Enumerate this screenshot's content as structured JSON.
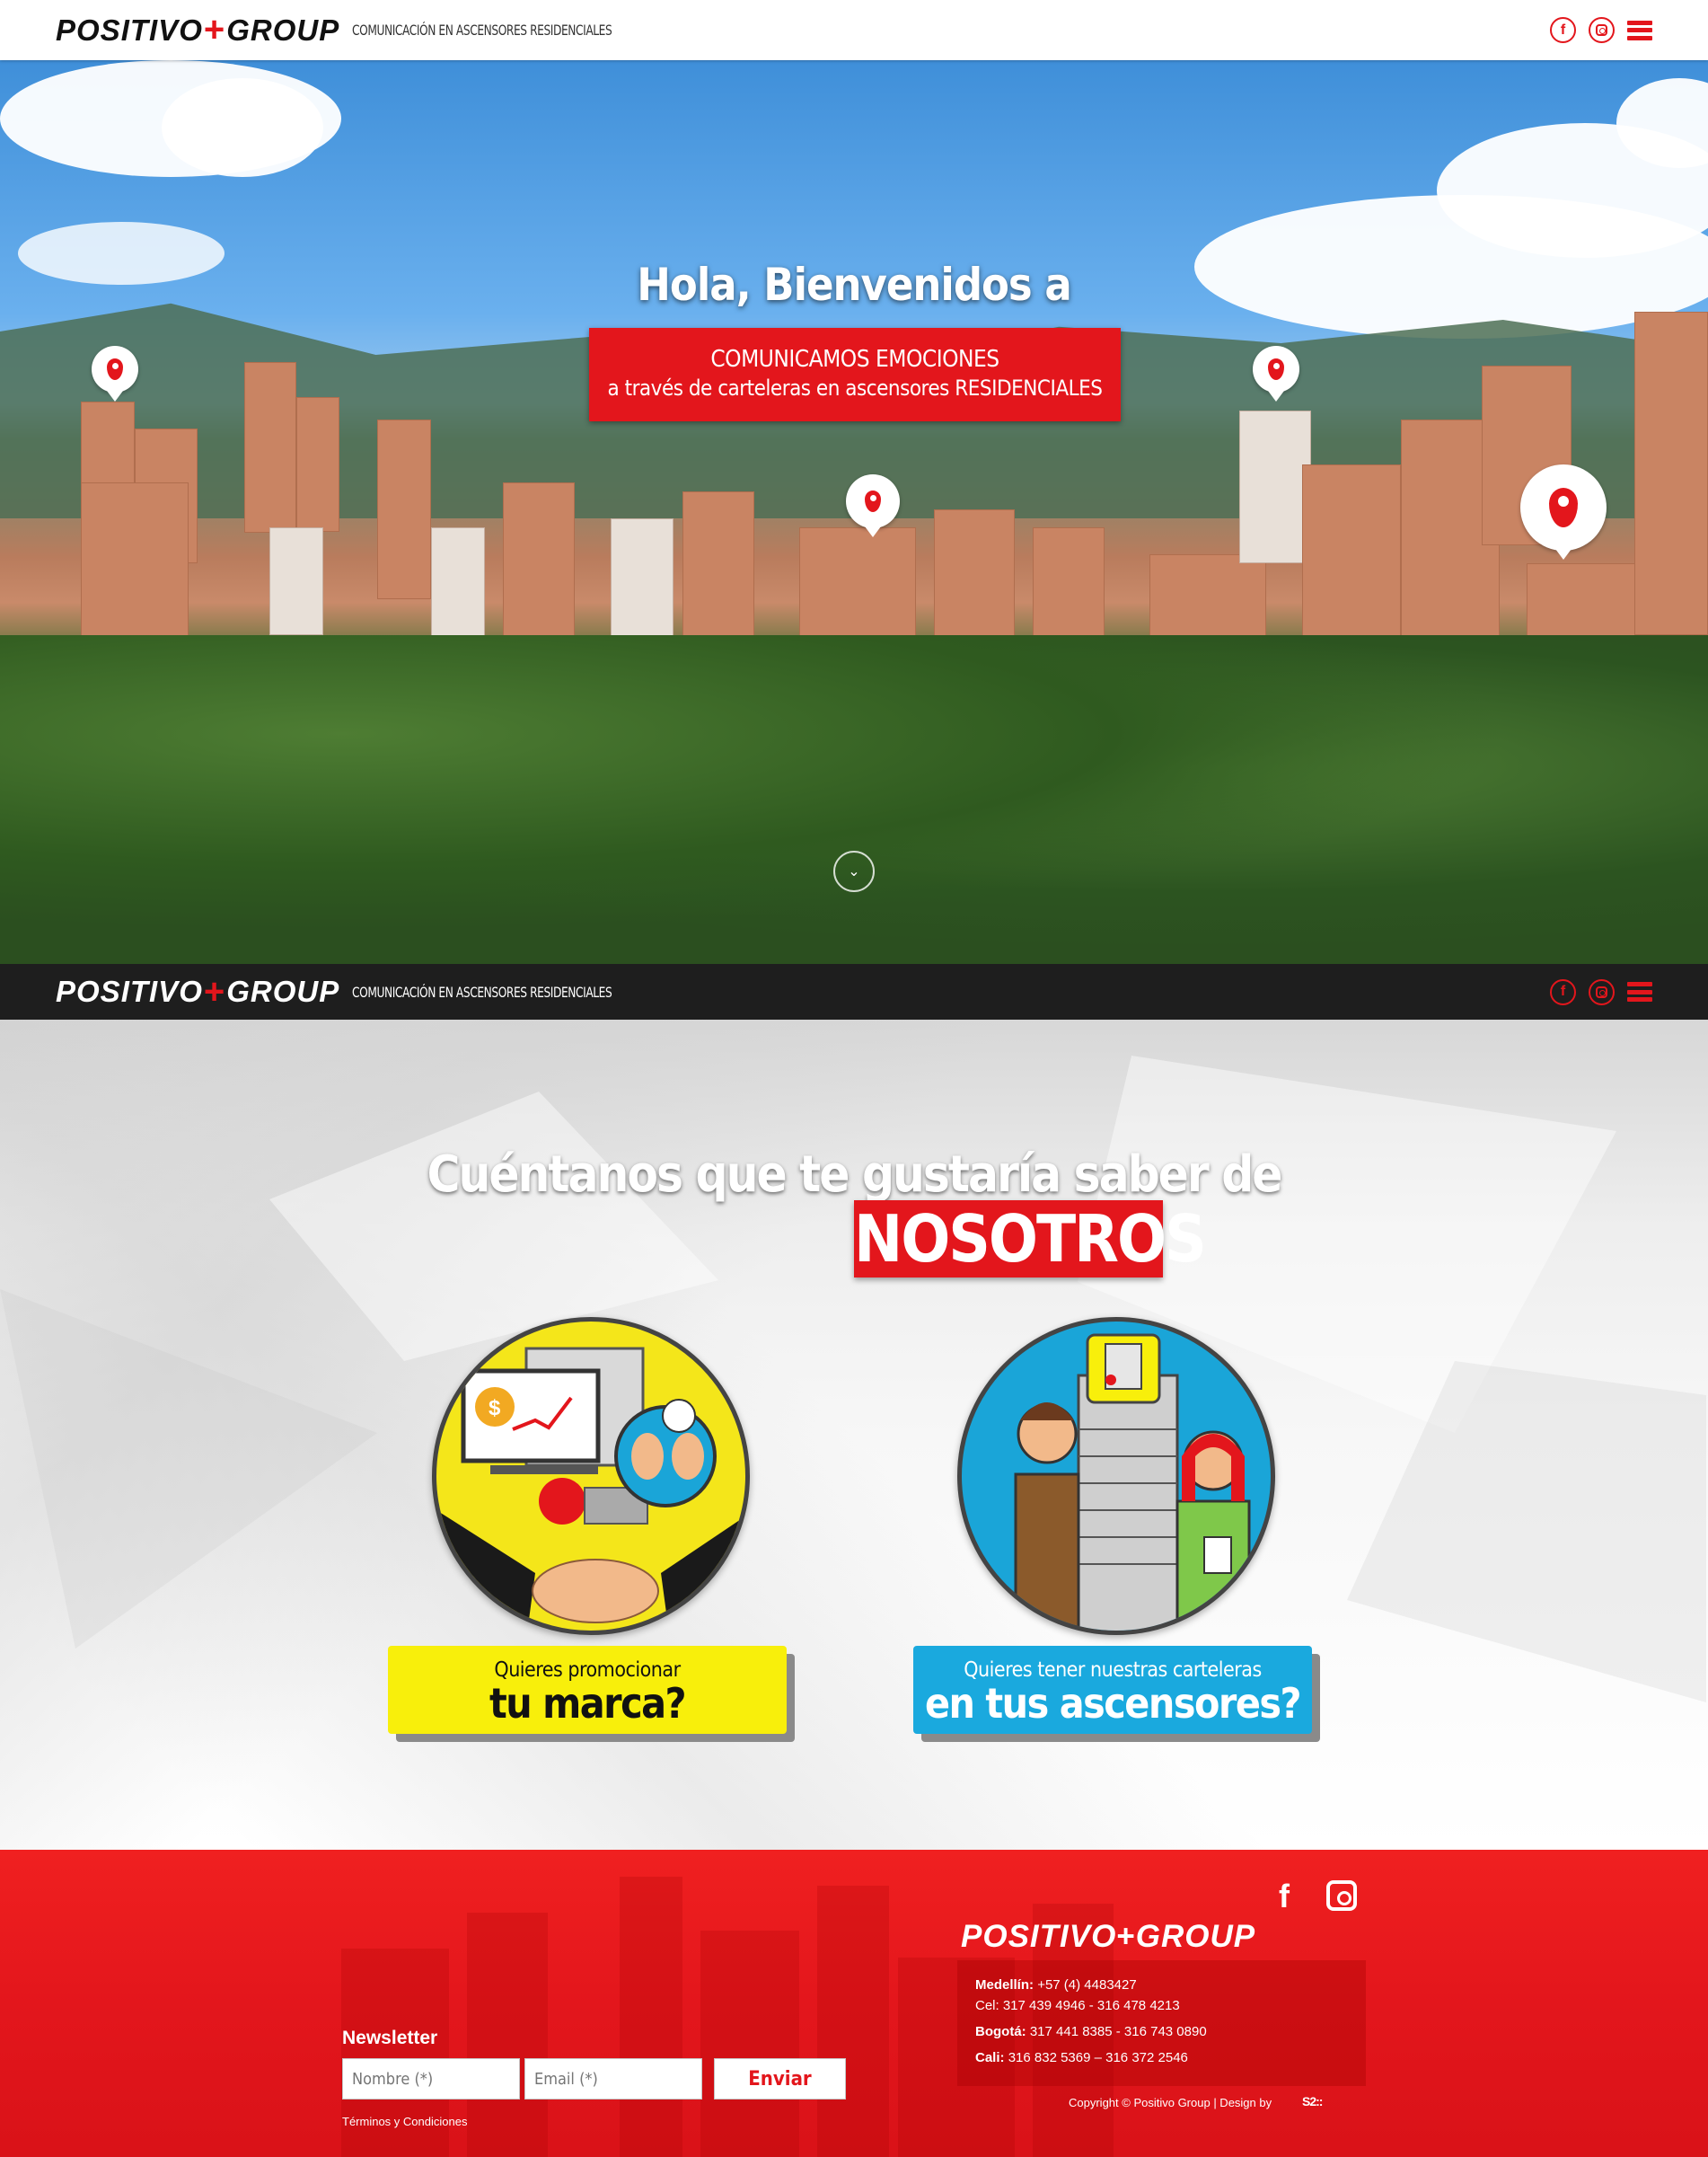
{
  "header": {
    "logo_left": "POSITIVO",
    "logo_plus": "+",
    "logo_right": "GROUP",
    "tagline": "COMUNICACIÓN EN ASCENSORES RESIDENCIALES",
    "facebook_glyph": "f",
    "icons": [
      "facebook-icon",
      "instagram-icon",
      "menu-icon"
    ]
  },
  "hero": {
    "title": "Hola, Bienvenidos a",
    "box_line1": "COMUNICAMOS EMOCIONES",
    "box_line2": "a través de carteleras en ascensores RESIDENCIALES",
    "scroll_glyph": "⌄"
  },
  "info": {
    "title_line1": "Cuéntanos que te gustaría saber de",
    "title_highlight": "NOSOTROS",
    "cards": [
      {
        "small": "Quieres promocionar",
        "large": "tu marca?"
      },
      {
        "small": "Quieres tener nuestras carteleras",
        "large": "en tus ascensores?"
      }
    ]
  },
  "footer": {
    "facebook_glyph": "f",
    "logo_left": "POSITIVO",
    "logo_plus": "+",
    "logo_right": "GROUP",
    "contacts": [
      {
        "city": "Medellín:",
        "phones": "+57 (4) 4483427"
      },
      {
        "city": "",
        "phones": "Cel: 317 439 4946 - 316 478 4213"
      },
      {
        "city": "Bogotá:",
        "phones": "317 441 8385 - 316 743 0890"
      },
      {
        "city": "Cali:",
        "phones": "316 832 5369 – 316 372 2546"
      }
    ],
    "copyright": "Copyright © Positivo Group | Design by",
    "designer_logo": "S2::",
    "newsletter": {
      "label": "Newsletter",
      "name_placeholder": "Nombre (*)",
      "email_placeholder": "Email (*)",
      "submit_label": "Enviar",
      "terms": "Términos y Condiciones"
    }
  },
  "colors": {
    "accent": "#e3161c",
    "yellow": "#f8ef0b",
    "blue": "#1aa9de",
    "dark_bar": "#1e1e1e"
  }
}
